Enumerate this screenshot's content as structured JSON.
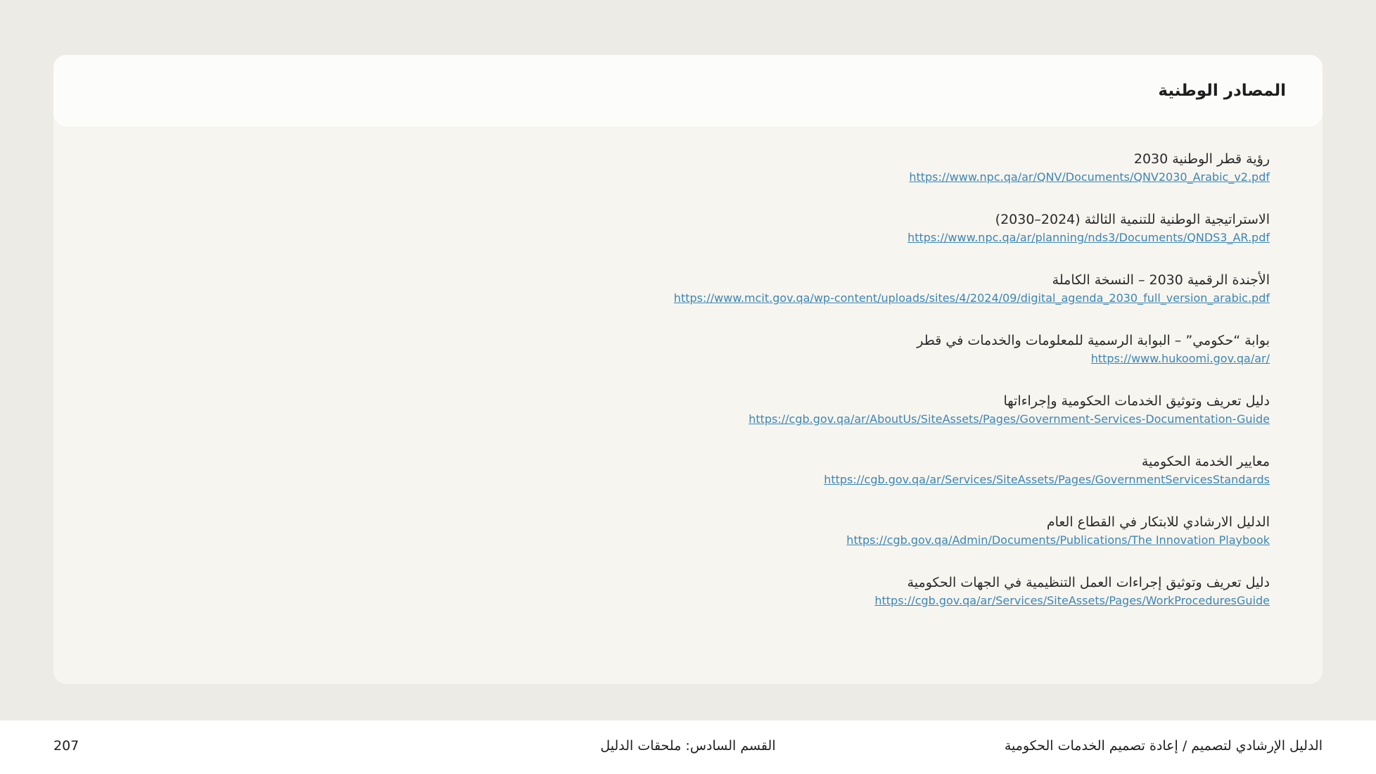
{
  "card": {
    "title": "المصادر الوطنية"
  },
  "sources": [
    {
      "title": "رؤية قطر الوطنية 2030",
      "url": "https://www.npc.qa/ar/QNV/Documents/QNV2030_Arabic_v2.pdf"
    },
    {
      "title": "الاستراتيجية الوطنية للتنمية الثالثة (2024–2030)",
      "url": "https://www.npc.qa/ar/planning/nds3/Documents/QNDS3_AR.pdf"
    },
    {
      "title": "الأجندة الرقمية 2030 – النسخة الكاملة",
      "url": "https://www.mcit.gov.qa/wp-content/uploads/sites/4/2024/09/digital_agenda_2030_full_version_arabic.pdf"
    },
    {
      "title": "بوابة “حكومي” – البوابة الرسمية للمعلومات والخدمات في قطر",
      "url": "https://www.hukoomi.gov.qa/ar/"
    },
    {
      "title": "دليل تعريف وتوثيق الخدمات الحكومية وإجراءاتها",
      "url": "https://cgb.gov.qa/ar/AboutUs/SiteAssets/Pages/Government-Services-Documentation-Guide"
    },
    {
      "title": "معايير الخدمة الحكومية",
      "url": "https://cgb.gov.qa/ar/Services/SiteAssets/Pages/GovernmentServicesStandards"
    },
    {
      "title": "الدليل الارشادي للابتكار في القطاع العام",
      "url": "https://cgb.gov.qa/Admin/Documents/Publications/The Innovation Playbook"
    },
    {
      "title": "دليل تعريف وتوثيق إجراءات العمل التنظيمية في الجهات الحكومية",
      "url": "https://cgb.gov.qa/ar/Services/SiteAssets/Pages/WorkProceduresGuide"
    }
  ],
  "footer": {
    "guide_title": "الدليل الإرشادي لتصميم / إعادة تصميم الخدمات الحكومية",
    "section": "القسم السادس: ملحقات الدليل",
    "page_number": "207"
  },
  "colors": {
    "link": "#3d86b3",
    "background": "#edebe5",
    "card": "#f6f5f0"
  }
}
